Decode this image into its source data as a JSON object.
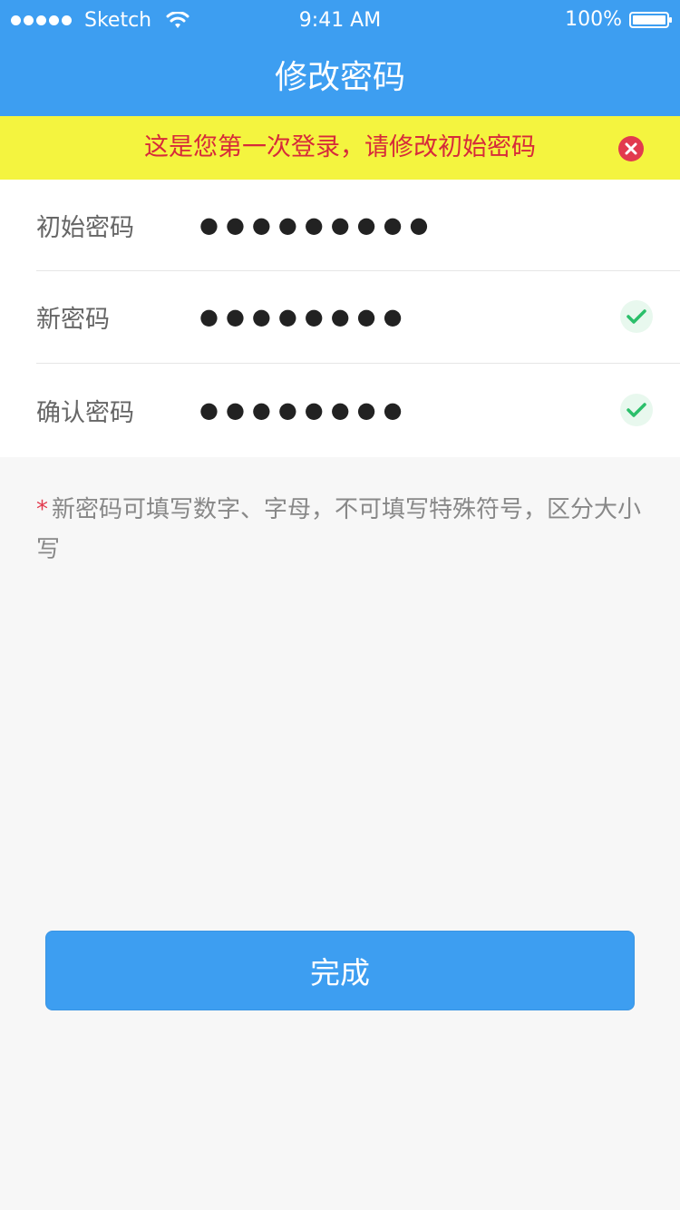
{
  "status": {
    "carrier": "Sketch",
    "time": "9:41 AM",
    "battery": "100%"
  },
  "nav": {
    "title": "修改密码"
  },
  "alert": {
    "message": "这是您第一次登录，请修改初始密码"
  },
  "form": {
    "rows": [
      {
        "label": "初始密码",
        "value": "●●●●●●●●●"
      },
      {
        "label": "新密码",
        "value": "●●●●●●●●"
      },
      {
        "label": "确认密码",
        "value": "●●●●●●●●"
      }
    ]
  },
  "hint": {
    "star": "*",
    "text": "新密码可填写数字、字母，不可填写特殊符号，区分大小写"
  },
  "actions": {
    "submit_label": "完成"
  },
  "colors": {
    "primary": "#3d9ef1",
    "alert_bg": "#f4f43f",
    "alert_text": "#d62a3a",
    "success": "#2bbf6a"
  },
  "icons": {
    "close": "close-icon",
    "valid": "check-icon",
    "wifi": "wifi-icon",
    "battery": "battery-icon"
  }
}
